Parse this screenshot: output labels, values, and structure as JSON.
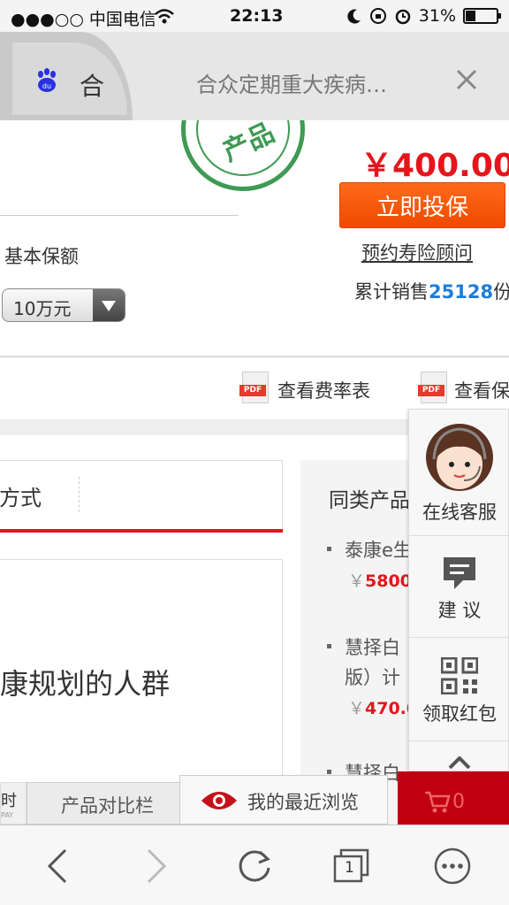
{
  "status_bar": {
    "carrier": "●●●○○ 中国电信",
    "time": "22:13",
    "battery": "31%"
  },
  "browser_tab": {
    "tab_char": "合",
    "title": "合众定期重大疾病…"
  },
  "product": {
    "stamp_text": "产品",
    "price": "￥400.00",
    "buy_label": "立即投保",
    "advisor_label": "预约寿险顾问",
    "sales_prefix": "累计销售",
    "sales_count": "25128",
    "sales_suffix": "份",
    "base_label": "基本保额",
    "amount_selected": "10万元"
  },
  "doc_links": {
    "rate_table": "查看费率表",
    "clause": "查看保"
  },
  "detail_tabs": {
    "visible_tab": "方式"
  },
  "body_text": "康规划的人群",
  "similar_products": {
    "title": "同类产品",
    "items": [
      {
        "name": "泰康e生",
        "price_yen": "￥",
        "price": "5800."
      },
      {
        "name": "慧择白",
        "name2": "版）计",
        "price_yen": "￥",
        "price": "470.0"
      },
      {
        "name": "慧择白"
      }
    ]
  },
  "service_panel": {
    "online": "在线客服",
    "suggest": "建 议",
    "redpack": "领取红包"
  },
  "bottom_bar": {
    "left_small": "时",
    "left_small2": "PAY",
    "compare": "产品对比栏",
    "recent": "我的最近浏览",
    "cart_count": "0"
  },
  "toolbar": {
    "tab_count": "1"
  }
}
